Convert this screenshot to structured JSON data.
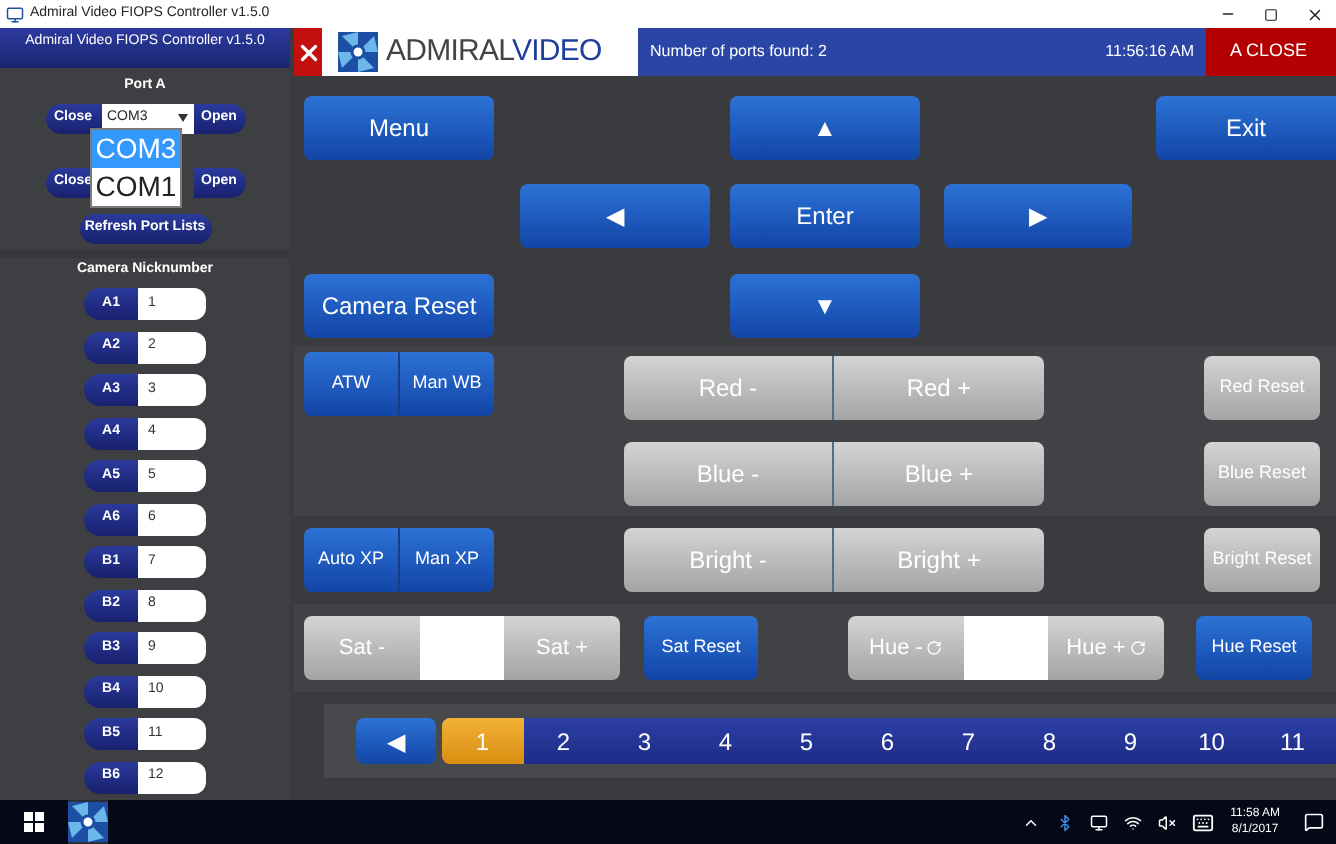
{
  "window": {
    "title": "Admiral Video FIOPS Controller v1.5.0"
  },
  "sidebar": {
    "header": "Admiral Video FIOPS Controller v1.5.0",
    "port_label": "Port A",
    "port_rows": [
      {
        "close": "Close",
        "select_value": "COM3",
        "open": "Open"
      },
      {
        "close": "Close",
        "open": "Open"
      }
    ],
    "dropdown": {
      "options": [
        {
          "label": "COM3",
          "selected": true
        },
        {
          "label": "COM1",
          "selected": false
        }
      ]
    },
    "refresh": "Refresh Port Lists",
    "nick_heading": "Camera Nicknumber",
    "cameras": [
      {
        "label": "A1",
        "value": "1"
      },
      {
        "label": "A2",
        "value": "2"
      },
      {
        "label": "A3",
        "value": "3"
      },
      {
        "label": "A4",
        "value": "4"
      },
      {
        "label": "A5",
        "value": "5"
      },
      {
        "label": "A6",
        "value": "6"
      },
      {
        "label": "B1",
        "value": "7"
      },
      {
        "label": "B2",
        "value": "8"
      },
      {
        "label": "B3",
        "value": "9"
      },
      {
        "label": "B4",
        "value": "10"
      },
      {
        "label": "B5",
        "value": "11"
      },
      {
        "label": "B6",
        "value": "12"
      }
    ]
  },
  "header": {
    "logo_left": "ADMIRAL",
    "logo_right": "VIDEO",
    "status": "Number of ports found: 2",
    "time": "11:56:16 AM",
    "close_all": "A CLOSE"
  },
  "nav": {
    "menu": "Menu",
    "up": "▲",
    "exit": "Exit",
    "left": "◀",
    "enter": "Enter",
    "right": "▶",
    "camera_reset": "Camera Reset",
    "down": "▼"
  },
  "white_balance": [
    "ATW",
    "Man WB"
  ],
  "exposure": [
    "Auto XP",
    "Man XP"
  ],
  "adjust_rows": [
    {
      "minus": "Red -",
      "plus": "Red +",
      "reset": "Red Reset",
      "disabled": true,
      "reset_disabled": true
    },
    {
      "minus": "Blue -",
      "plus": "Blue +",
      "reset": "Blue Reset",
      "disabled": true,
      "reset_disabled": true
    },
    {
      "minus": "Bright -",
      "plus": "Bright +",
      "reset": "Bright Reset",
      "disabled": true,
      "reset_disabled": true
    }
  ],
  "sat": {
    "minus": "Sat -",
    "plus": "Sat +",
    "reset": "Sat Reset",
    "disabled": true,
    "reset_disabled": false
  },
  "hue": {
    "minus": "Hue -",
    "plus": "Hue +",
    "reset": "Hue Reset",
    "disabled": true,
    "reset_disabled": false
  },
  "pager": {
    "back": "◀",
    "pages": [
      {
        "label": "1",
        "selected": true
      },
      {
        "label": "2",
        "selected": false
      },
      {
        "label": "3",
        "selected": false
      },
      {
        "label": "4",
        "selected": false
      },
      {
        "label": "5",
        "selected": false
      },
      {
        "label": "6",
        "selected": false
      },
      {
        "label": "7",
        "selected": false
      },
      {
        "label": "8",
        "selected": false
      },
      {
        "label": "9",
        "selected": false
      },
      {
        "label": "10",
        "selected": false
      },
      {
        "label": "11",
        "selected": false
      }
    ]
  },
  "taskbar": {
    "time": "11:58 AM",
    "date": "8/1/2017"
  }
}
